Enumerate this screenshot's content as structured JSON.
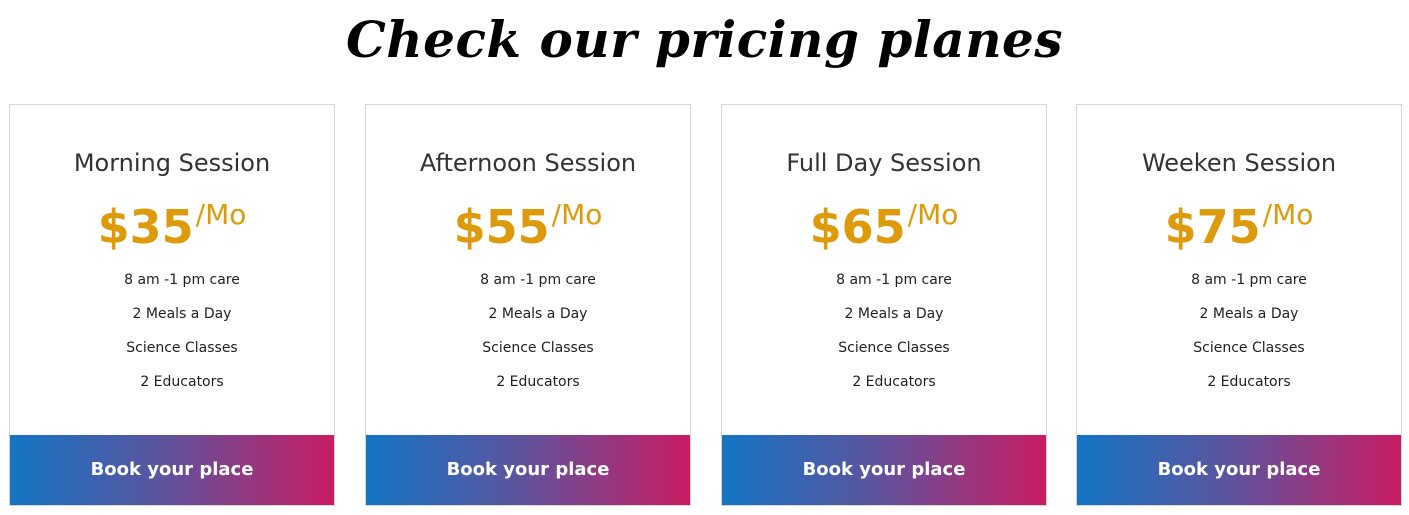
{
  "heading": "Check our pricing planes",
  "colors": {
    "price": "#dd9a0b",
    "button_gradient_start": "#1475c4",
    "button_gradient_end": "#c91d63",
    "title": "#333333"
  },
  "plans": [
    {
      "title": "Morning Session",
      "price": "$35",
      "per": "/Mo",
      "features": [
        "8 am -1 pm care",
        "2 Meals a Day",
        "Science Classes",
        "2 Educators"
      ],
      "button": "Book your place"
    },
    {
      "title": "Afternoon Session",
      "price": "$55",
      "per": "/Mo",
      "features": [
        "8 am -1 pm care",
        "2 Meals a Day",
        "Science Classes",
        "2 Educators"
      ],
      "button": "Book your place"
    },
    {
      "title": "Full Day Session",
      "price": "$65",
      "per": "/Mo",
      "features": [
        "8 am -1 pm care",
        "2 Meals a Day",
        "Science Classes",
        "2 Educators"
      ],
      "button": "Book your place"
    },
    {
      "title": "Weeken Session",
      "price": "$75",
      "per": "/Mo",
      "features": [
        "8 am -1 pm care",
        "2 Meals a Day",
        "Science Classes",
        "2 Educators"
      ],
      "button": "Book your place"
    }
  ]
}
